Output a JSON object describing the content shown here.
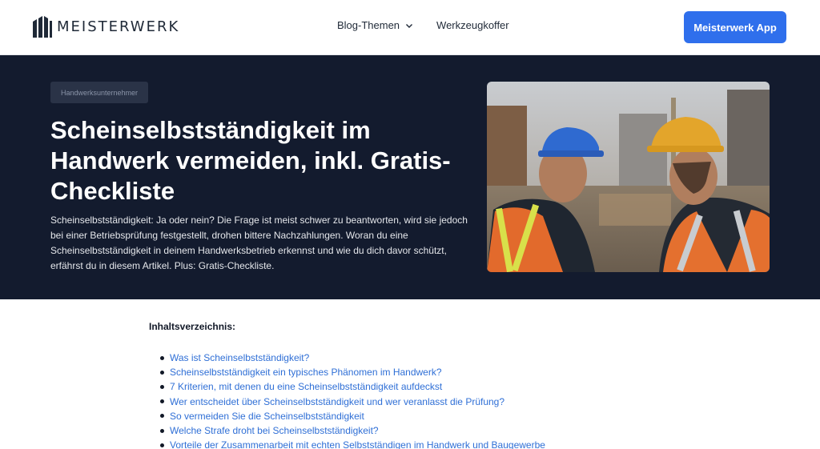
{
  "header": {
    "logo_text": "MEISTERWERK",
    "nav": [
      {
        "label": "Blog-Themen",
        "has_dropdown": true
      },
      {
        "label": "Werkzeugkoffer",
        "has_dropdown": false
      }
    ],
    "cta_label": "Meisterwerk App"
  },
  "hero": {
    "tag": "Handwerksunternehmer",
    "title": "Scheinselbstständigkeit im Handwerk vermeiden, inkl. Gratis-Checkliste",
    "lead": "Scheinselbstständigkeit: Ja oder nein? Die Frage ist meist schwer zu beantworten, wird sie jedoch bei einer Betriebsprüfung festgestellt, drohen bittere Nachzahlungen. Woran du eine Scheinselbstständigkeit in deinem Handwerksbetrieb erkennst und wie du dich davor schützt, erfährst du in diesem Artikel. Plus: Gratis-Checkliste."
  },
  "toc": {
    "title": "Inhaltsverzeichnis:",
    "items": [
      "Was ist Scheinselbstständigkeit?",
      "Scheinselbstständigkeit ein typisches Phänomen im Handwerk?",
      "7 Kriterien, mit denen du eine Scheinselbstständigkeit aufdeckst",
      "Wer entscheidet über Scheinselbstständigkeit und wer veranlasst die Prüfung?",
      "So vermeiden Sie die Scheinselbstständigkeit",
      "Welche Strafe droht bei Scheinselbstständigkeit?",
      "Vorteile der Zusammenarbeit mit echten Selbstständigen im Handwerk und Baugewerbe"
    ]
  },
  "colors": {
    "hero_bg": "#131b2e",
    "cta": "#2f6fec",
    "link": "#2f6fd6"
  },
  "icons": [
    "logo-mark-icon",
    "chevron-down-icon"
  ]
}
